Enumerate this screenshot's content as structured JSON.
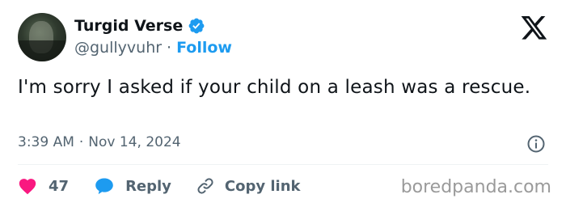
{
  "author": {
    "display_name": "Turgid Verse",
    "handle": "@gullyvuhr",
    "separator": "·",
    "follow_label": "Follow",
    "verified": true
  },
  "tweet": {
    "text": "I'm sorry I asked if your child on a leash was a rescue.",
    "time": "3:39 AM",
    "separator": "·",
    "date": "Nov 14, 2024"
  },
  "actions": {
    "likes": "47",
    "reply_label": "Reply",
    "copy_link_label": "Copy link"
  },
  "icons": {
    "logo": "x-logo-icon",
    "verified": "verified-badge-icon",
    "info": "info-icon",
    "like": "heart-icon",
    "reply": "speech-bubble-icon",
    "copy": "link-icon"
  },
  "colors": {
    "accent": "#1d9bf0",
    "like": "#f91880",
    "muted": "#536471",
    "text": "#0f1419"
  },
  "watermark": "boredpanda.com"
}
